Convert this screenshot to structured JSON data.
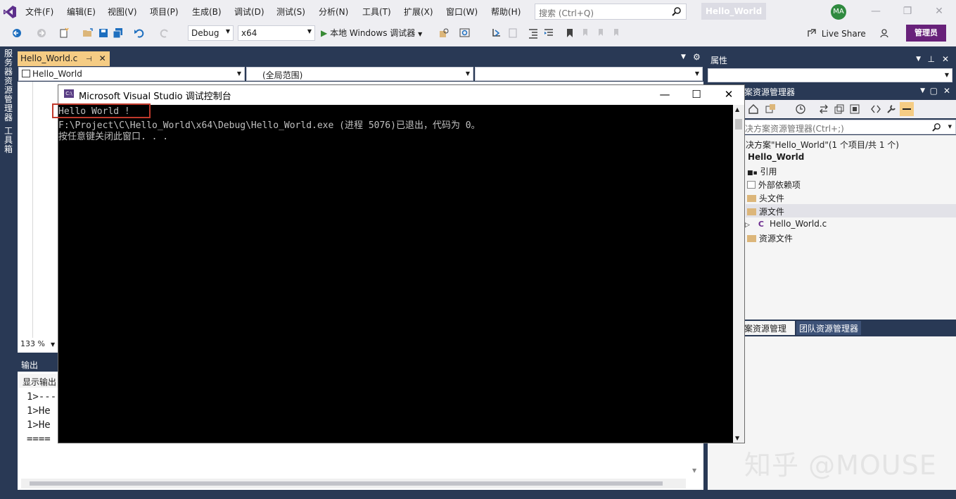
{
  "menubar": {
    "items": [
      "文件(F)",
      "编辑(E)",
      "视图(V)",
      "项目(P)",
      "生成(B)",
      "调试(D)",
      "测试(S)",
      "分析(N)",
      "工具(T)",
      "扩展(X)",
      "窗口(W)",
      "帮助(H)"
    ],
    "search_placeholder": "搜索 (Ctrl+Q)",
    "solution_title": "Hello_World",
    "avatar_initials": "MA"
  },
  "toolbar": {
    "config": "Debug",
    "platform": "x64",
    "run_label": "本地 Windows 调试器",
    "live_share": "Live Share",
    "admin_label": "管理员"
  },
  "left_strip": {
    "server_explorer": "服务器资源管理器",
    "toolbox": "工具箱"
  },
  "editor": {
    "tab_label": "Hello_World.c",
    "nav_project": "Hello_World",
    "nav_scope": "(全局范围)",
    "zoom": "133 %"
  },
  "output": {
    "title": "输出",
    "source_label": "显示输出",
    "lines": [
      "1>---",
      "1>He",
      "1>He",
      "===="
    ]
  },
  "properties": {
    "title": "属性"
  },
  "solution_explorer": {
    "title": "案资源管理器",
    "search_placeholder": "决方案资源管理器(Ctrl+;)",
    "solution_line": "决方案\"Hello_World\"(1 个项目/共 1 个)",
    "project": "Hello_World",
    "nodes": [
      "引用",
      "外部依赖项",
      "头文件",
      "源文件",
      "Hello_World.c",
      "资源文件"
    ],
    "tab_solution": "案资源管理器",
    "tab_team": "团队资源管理器"
  },
  "console": {
    "title": "Microsoft Visual Studio 调试控制台",
    "lines": [
      "Hello World !",
      "F:\\Project\\C\\Hello_World\\x64\\Debug\\Hello_World.exe (进程 5076)已退出，代码为 0。",
      "按任意键关闭此窗口. . ."
    ]
  },
  "watermark": "知乎 @MOUSE",
  "colors": {
    "vs_blue": "#293955",
    "active_tab": "#f5cc84",
    "admin_purple": "#68217a",
    "highlight_red": "#c0392b"
  }
}
